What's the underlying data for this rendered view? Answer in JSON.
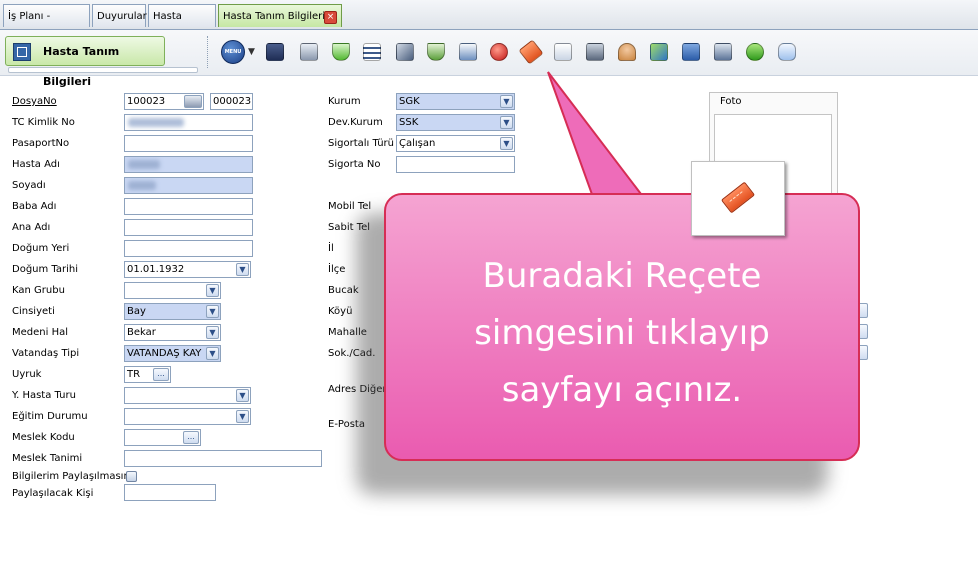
{
  "tabs": [
    {
      "label": "İş Planı - Ajanda"
    },
    {
      "label": "Duyurular"
    },
    {
      "label": "Hasta Listesi"
    },
    {
      "label": "Hasta Tanım Bilgileri",
      "close": "×"
    }
  ],
  "form_title": "Hasta Tanım Bilgileri",
  "toolbar": {
    "menu_label": "MENU",
    "icons": [
      "menu-icon",
      "save-icon",
      "print-icon",
      "lab-flask-icon",
      "checklist-icon",
      "microscope-icon",
      "lab-info-icon",
      "document-edit-icon",
      "red-ball-icon",
      "prescription-icon",
      "medical-kit-info-icon",
      "scanner-icon",
      "user-info-icon",
      "pen-icon",
      "calendar-add-icon",
      "file-add-icon",
      "download-arrow-icon",
      "chat-bubble-icon"
    ]
  },
  "left": {
    "dosyano_label": "DosyaNo",
    "dosyano_value": "100023",
    "dosyano_value2": "000023",
    "tc_label": "TC Kimlik No",
    "pasaport_label": "PasaportNo",
    "hasta_adi_label": "Hasta Adı",
    "soyadi_label": "Soyadı",
    "baba_label": "Baba Adı",
    "ana_label": "Ana Adı",
    "dogum_yeri_label": "Doğum Yeri",
    "dogum_tarihi_label": "Doğum Tarihi",
    "dogum_tarihi_value": "01.01.1932",
    "kan_label": "Kan Grubu",
    "cinsiyet_label": "Cinsiyeti",
    "cinsiyet_value": "Bay",
    "medeni_label": "Medeni Hal",
    "medeni_value": "Bekar",
    "vatandas_label": "Vatandaş Tipi",
    "vatandas_value": "VATANDAŞ KAY",
    "uyruk_label": "Uyruk",
    "uyruk_value": "TR",
    "y_hasta_label": "Y. Hasta Turu",
    "egitim_label": "Eğitim Durumu",
    "meslek_kodu_label": "Meslek Kodu",
    "meslek_tanimi_label": "Meslek Tanimi",
    "paylasim_label": "Bilgilerim Paylaşılmasın",
    "paylasilacak_label": "Paylaşılacak Kişi"
  },
  "mid": {
    "kurum_label": "Kurum",
    "kurum_value": "SGK",
    "dev_kurum_label": "Dev.Kurum",
    "dev_kurum_value": "SSK",
    "sigortali_label": "Sigortalı Türü",
    "sigortali_value": "Çalışan",
    "sigorta_no_label": "Sigorta No",
    "mobil_label": "Mobil Tel",
    "sabit_label": "Sabit Tel",
    "il_label": "İl",
    "ilce_label": "İlçe",
    "bucak_label": "Bucak",
    "koyu_label": "Köyü",
    "mahalle_label": "Mahalle",
    "sok_label": "Sok./Cad.",
    "adres_label": "Adres Diğer",
    "eposta_label": "E-Posta"
  },
  "foto_label": "Foto",
  "callout": {
    "line1": "Buradaki Reçete",
    "line2": "simgesini tıklayıp",
    "line3": "sayfayı açınız."
  },
  "colors": {
    "callout_fill": "#ee6cb9",
    "callout_border": "#d62d55",
    "required_field": "#c9d7f3",
    "active_tab": "#c6e7a4"
  }
}
